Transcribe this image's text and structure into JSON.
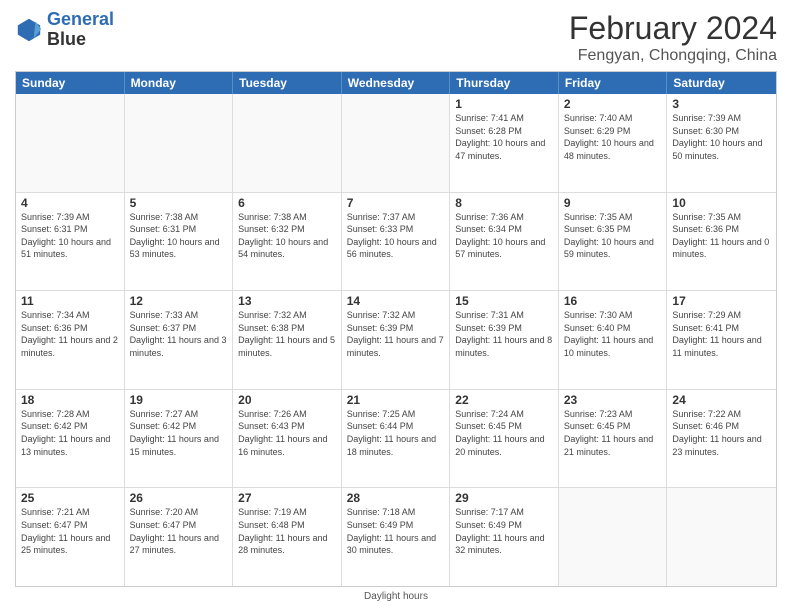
{
  "header": {
    "logo_line1": "General",
    "logo_line2": "Blue",
    "title": "February 2024",
    "subtitle": "Fengyan, Chongqing, China"
  },
  "days_of_week": [
    "Sunday",
    "Monday",
    "Tuesday",
    "Wednesday",
    "Thursday",
    "Friday",
    "Saturday"
  ],
  "footer": "Daylight hours",
  "weeks": [
    [
      {
        "day": "",
        "info": ""
      },
      {
        "day": "",
        "info": ""
      },
      {
        "day": "",
        "info": ""
      },
      {
        "day": "",
        "info": ""
      },
      {
        "day": "1",
        "info": "Sunrise: 7:41 AM\nSunset: 6:28 PM\nDaylight: 10 hours and 47 minutes."
      },
      {
        "day": "2",
        "info": "Sunrise: 7:40 AM\nSunset: 6:29 PM\nDaylight: 10 hours and 48 minutes."
      },
      {
        "day": "3",
        "info": "Sunrise: 7:39 AM\nSunset: 6:30 PM\nDaylight: 10 hours and 50 minutes."
      }
    ],
    [
      {
        "day": "4",
        "info": "Sunrise: 7:39 AM\nSunset: 6:31 PM\nDaylight: 10 hours and 51 minutes."
      },
      {
        "day": "5",
        "info": "Sunrise: 7:38 AM\nSunset: 6:31 PM\nDaylight: 10 hours and 53 minutes."
      },
      {
        "day": "6",
        "info": "Sunrise: 7:38 AM\nSunset: 6:32 PM\nDaylight: 10 hours and 54 minutes."
      },
      {
        "day": "7",
        "info": "Sunrise: 7:37 AM\nSunset: 6:33 PM\nDaylight: 10 hours and 56 minutes."
      },
      {
        "day": "8",
        "info": "Sunrise: 7:36 AM\nSunset: 6:34 PM\nDaylight: 10 hours and 57 minutes."
      },
      {
        "day": "9",
        "info": "Sunrise: 7:35 AM\nSunset: 6:35 PM\nDaylight: 10 hours and 59 minutes."
      },
      {
        "day": "10",
        "info": "Sunrise: 7:35 AM\nSunset: 6:36 PM\nDaylight: 11 hours and 0 minutes."
      }
    ],
    [
      {
        "day": "11",
        "info": "Sunrise: 7:34 AM\nSunset: 6:36 PM\nDaylight: 11 hours and 2 minutes."
      },
      {
        "day": "12",
        "info": "Sunrise: 7:33 AM\nSunset: 6:37 PM\nDaylight: 11 hours and 3 minutes."
      },
      {
        "day": "13",
        "info": "Sunrise: 7:32 AM\nSunset: 6:38 PM\nDaylight: 11 hours and 5 minutes."
      },
      {
        "day": "14",
        "info": "Sunrise: 7:32 AM\nSunset: 6:39 PM\nDaylight: 11 hours and 7 minutes."
      },
      {
        "day": "15",
        "info": "Sunrise: 7:31 AM\nSunset: 6:39 PM\nDaylight: 11 hours and 8 minutes."
      },
      {
        "day": "16",
        "info": "Sunrise: 7:30 AM\nSunset: 6:40 PM\nDaylight: 11 hours and 10 minutes."
      },
      {
        "day": "17",
        "info": "Sunrise: 7:29 AM\nSunset: 6:41 PM\nDaylight: 11 hours and 11 minutes."
      }
    ],
    [
      {
        "day": "18",
        "info": "Sunrise: 7:28 AM\nSunset: 6:42 PM\nDaylight: 11 hours and 13 minutes."
      },
      {
        "day": "19",
        "info": "Sunrise: 7:27 AM\nSunset: 6:42 PM\nDaylight: 11 hours and 15 minutes."
      },
      {
        "day": "20",
        "info": "Sunrise: 7:26 AM\nSunset: 6:43 PM\nDaylight: 11 hours and 16 minutes."
      },
      {
        "day": "21",
        "info": "Sunrise: 7:25 AM\nSunset: 6:44 PM\nDaylight: 11 hours and 18 minutes."
      },
      {
        "day": "22",
        "info": "Sunrise: 7:24 AM\nSunset: 6:45 PM\nDaylight: 11 hours and 20 minutes."
      },
      {
        "day": "23",
        "info": "Sunrise: 7:23 AM\nSunset: 6:45 PM\nDaylight: 11 hours and 21 minutes."
      },
      {
        "day": "24",
        "info": "Sunrise: 7:22 AM\nSunset: 6:46 PM\nDaylight: 11 hours and 23 minutes."
      }
    ],
    [
      {
        "day": "25",
        "info": "Sunrise: 7:21 AM\nSunset: 6:47 PM\nDaylight: 11 hours and 25 minutes."
      },
      {
        "day": "26",
        "info": "Sunrise: 7:20 AM\nSunset: 6:47 PM\nDaylight: 11 hours and 27 minutes."
      },
      {
        "day": "27",
        "info": "Sunrise: 7:19 AM\nSunset: 6:48 PM\nDaylight: 11 hours and 28 minutes."
      },
      {
        "day": "28",
        "info": "Sunrise: 7:18 AM\nSunset: 6:49 PM\nDaylight: 11 hours and 30 minutes."
      },
      {
        "day": "29",
        "info": "Sunrise: 7:17 AM\nSunset: 6:49 PM\nDaylight: 11 hours and 32 minutes."
      },
      {
        "day": "",
        "info": ""
      },
      {
        "day": "",
        "info": ""
      }
    ]
  ]
}
